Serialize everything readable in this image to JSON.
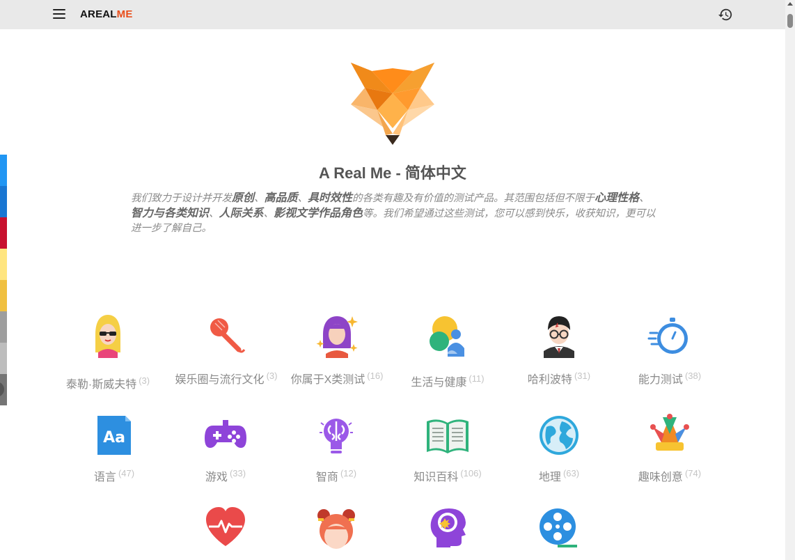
{
  "app": {
    "brand_main": "AREAL",
    "brand_accent": "ME"
  },
  "hero": {
    "title": "A Real Me - 简体中文",
    "desc_parts": [
      {
        "text": "我们致力于设计并开发",
        "bold": false
      },
      {
        "text": "原创",
        "bold": true
      },
      {
        "text": "、",
        "bold": false
      },
      {
        "text": "高品质",
        "bold": true
      },
      {
        "text": "、",
        "bold": false
      },
      {
        "text": "具时效性",
        "bold": true
      },
      {
        "text": "的各类有趣及有价值的测试产品。其范围包括但不限于",
        "bold": false
      },
      {
        "text": "心理性格",
        "bold": true
      },
      {
        "text": "、",
        "bold": false
      },
      {
        "text": "智力与各类知识",
        "bold": true
      },
      {
        "text": "、",
        "bold": false
      },
      {
        "text": "人际关系",
        "bold": true
      },
      {
        "text": "、",
        "bold": false
      },
      {
        "text": "影视文学作品角色",
        "bold": true
      },
      {
        "text": "等。我们希望通过这些测试，您可以感到快乐，收获知识，更可以进一步了解自己。",
        "bold": false
      }
    ]
  },
  "theme_colors": [
    "#2196f3",
    "#1976d2",
    "#c8102e",
    "#ffe57f",
    "#f0c040",
    "#9e9e9e",
    "#bdbdbd",
    "#757575"
  ],
  "categories": [
    {
      "label": "泰勒·斯威夫特",
      "count": "(3)",
      "icon": "taylor-swift-icon"
    },
    {
      "label": "娱乐圈与流行文化",
      "count": "(3)",
      "icon": "microphone-icon"
    },
    {
      "label": "你属于X类测试",
      "count": "(16)",
      "icon": "sparkle-girl-icon"
    },
    {
      "label": "生活与健康",
      "count": "(11)",
      "icon": "family-sun-icon"
    },
    {
      "label": "哈利波特",
      "count": "(31)",
      "icon": "harry-potter-icon"
    },
    {
      "label": "能力测试",
      "count": "(38)",
      "icon": "stopwatch-icon"
    },
    {
      "label": "语言",
      "count": "(47)",
      "icon": "font-aa-icon"
    },
    {
      "label": "游戏",
      "count": "(33)",
      "icon": "gamepad-icon"
    },
    {
      "label": "智商",
      "count": "(12)",
      "icon": "brain-bulb-icon"
    },
    {
      "label": "知识百科",
      "count": "(106)",
      "icon": "open-book-icon"
    },
    {
      "label": "地理",
      "count": "(63)",
      "icon": "globe-icon"
    },
    {
      "label": "趣味创意",
      "count": "(74)",
      "icon": "jester-hat-icon"
    },
    {
      "label": "",
      "count": "",
      "icon": "heartbeat-icon"
    },
    {
      "label": "",
      "count": "",
      "icon": "girl-buns-icon"
    },
    {
      "label": "",
      "count": "",
      "icon": "head-mind-icon"
    },
    {
      "label": "",
      "count": "",
      "icon": "film-reel-icon"
    }
  ]
}
